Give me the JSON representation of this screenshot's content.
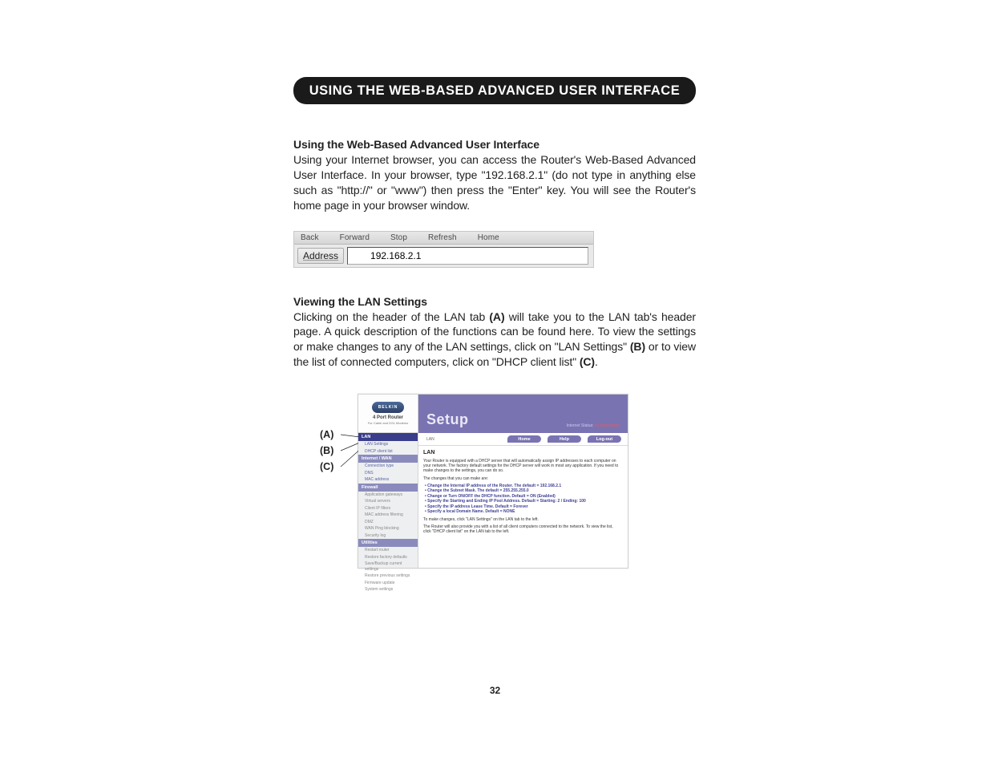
{
  "title_bar": "USING THE WEB-BASED ADVANCED USER INTERFACE",
  "section1": {
    "heading": "Using the Web-Based Advanced User Interface",
    "text": "Using your Internet browser, you can access the Router's Web-Based Advanced User Interface. In your browser, type \"192.168.2.1\" (do not type in anything else such as \"http://\" or \"www\") then press the \"Enter\" key. You will see the Router's home page in your browser window."
  },
  "address_bar": {
    "toolbar_items": [
      "Back",
      "Forward",
      "Stop",
      "Refresh",
      "Home"
    ],
    "label": "Address",
    "value": "192.168.2.1"
  },
  "section2": {
    "heading": "Viewing the LAN Settings",
    "pre_a": "Clicking on the header of the LAN tab ",
    "a": "(A)",
    "mid1": " will take you to the LAN tab's header page. A quick description of the functions can be found here. To view the settings or make changes to any of the LAN settings, click on \"LAN Settings\" ",
    "b": "(B)",
    "mid2": " or to view the list of connected computers, click on \"DHCP client list\" ",
    "c": "(C)",
    "end": "."
  },
  "labels": {
    "a": "(A)",
    "b": "(B)",
    "c": "(C)"
  },
  "router_ui": {
    "logo_brand": "BELKIN",
    "logo_product": "4 Port Router",
    "logo_product_sub": "For Cable and DSL Modems",
    "nav": {
      "lan_head": "LAN",
      "lan_items": [
        "LAN Settings",
        "DHCP client list"
      ],
      "wan_head": "Internet / WAN",
      "wan_items": [
        "Connection type",
        "DNS",
        "MAC address"
      ],
      "fw_head": "Firewall",
      "fw_items": [
        "Application gateways",
        "Virtual servers",
        "Client IP filters",
        "MAC address filtering",
        "DMZ",
        "WAN Ping blocking",
        "Security log"
      ],
      "util_head": "Utilities",
      "util_items": [
        "Restart router",
        "Restore factory defaults",
        "Save/Backup current settings",
        "Restore previous settings",
        "Firmware update",
        "System settings"
      ]
    },
    "header_title": "Setup",
    "status_label": "Internet Status:",
    "status_value": "no connection",
    "buttons": [
      "Home",
      "Help",
      "Log-out"
    ],
    "crumb": "LAN",
    "panel_title": "LAN",
    "panel_intro": "Your Router is equipped with a DHCP server that will automatically assign IP addresses to each computer on your network. The factory default settings for the DHCP server will work in most any application. If you need to make changes to the settings, you can do so.",
    "panel_changes_intro": "The changes that you can make are:",
    "bullets": [
      "• Change the Internal IP address of the Router. The default = 192.168.2.1",
      "• Change the Subnet Mask. The default = 255.255.255.0",
      "• Change or Turn ON/OFF the DHCP function. Default = ON (Enabled)",
      "• Specify the Starting and Ending IP Pool Address. Default = Starting: 2 / Ending: 100",
      "• Specify the IP address Lease Time. Default = Forever",
      "• Specify a local Domain Name. Default = NONE"
    ],
    "panel_note1": "To make changes, click \"LAN Settings\" on the LAN tab to the left.",
    "panel_note2": "The Router will also provide you with a list of all client computers connected to the network. To view the list, click \"DHCP client list\" on the LAN tab to the left."
  },
  "page_number": "32"
}
